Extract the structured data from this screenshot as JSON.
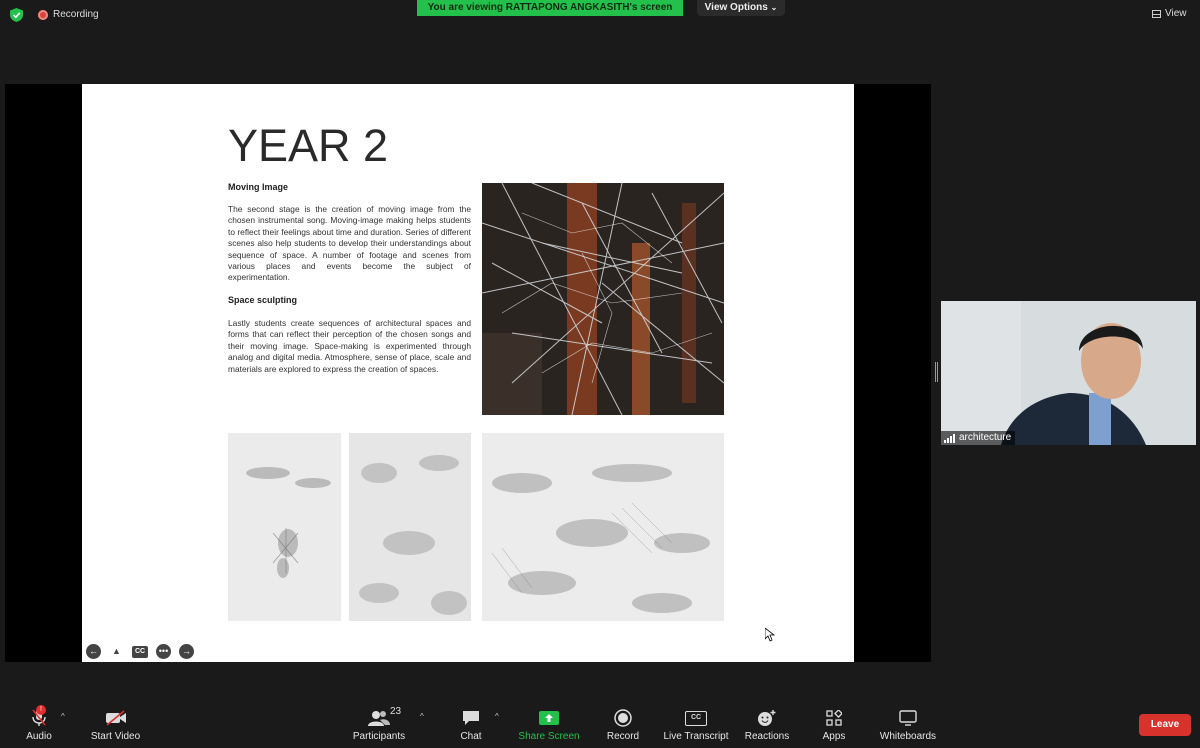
{
  "meeting": {
    "recording_label": "Recording",
    "viewing_banner": "You are viewing RATTAPONG ANGKASITH's screen",
    "view_options_label": "View Options",
    "view_label": "View"
  },
  "slide": {
    "title": "YEAR 2",
    "section1_heading": "Moving Image",
    "section1_body": "The second stage is the creation of moving image from the chosen instrumental song. Moving-image making helps students to reflect their feelings about time and duration. Series of different scenes also help students to develop their understandings about sequence of space. A number of footage and scenes from various places and events become the subject of experimentation.",
    "section2_heading": "Space sculpting",
    "section2_body": "Lastly students create sequences of architectural spaces and forms that can reflect their perception of the chosen songs and their moving image. Space-making is experimented through analog and digital media. Atmosphere, sense of place, scale and materials are explored to express the creation of spaces.",
    "controls": {
      "cc": "CC"
    }
  },
  "participant_video": {
    "name": "architecture"
  },
  "toolbar": {
    "audio": "Audio",
    "audio_badge": "!",
    "start_video": "Start Video",
    "participants": "Participants",
    "participants_count": "23",
    "chat": "Chat",
    "share_screen": "Share Screen",
    "record": "Record",
    "live_transcript": "Live Transcript",
    "live_transcript_icon_text": "CC",
    "reactions": "Reactions",
    "apps": "Apps",
    "whiteboards": "Whiteboards",
    "leave": "Leave"
  },
  "colors": {
    "banner_green": "#23c14b",
    "leave_red": "#d8322c",
    "share_green": "#23c14b"
  }
}
